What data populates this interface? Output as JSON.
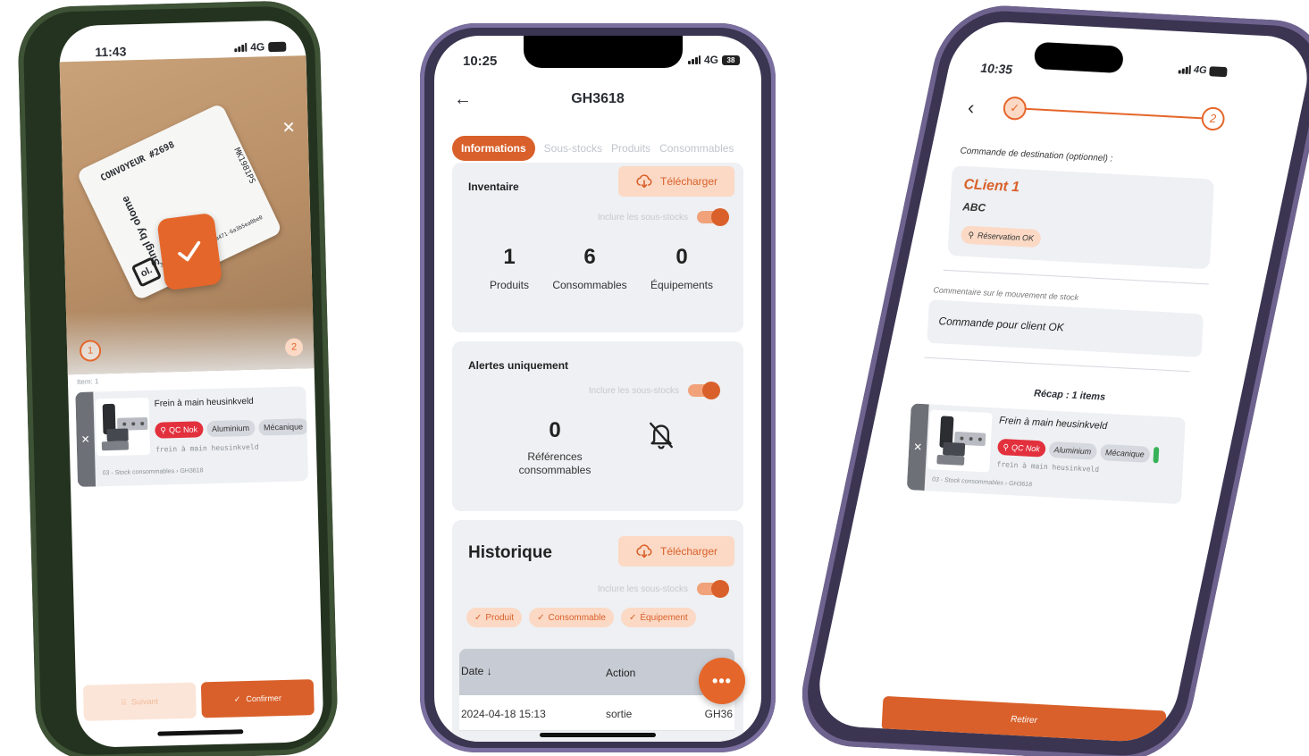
{
  "colors": {
    "accent": "#e5662a",
    "accent_dark": "#d9602a",
    "accent_light": "#fbd9c5",
    "danger": "#e2303d",
    "card_bg": "#eef0f3"
  },
  "phone1": {
    "time": "11:43",
    "network": "4G",
    "label": {
      "line1": "CONVOYEUR #2698",
      "brand": "Singl by olome",
      "code_side": "MK1981PS",
      "code_bottom": "30ed7213-5e6e-48ed-a471-6a3b5ea0be0",
      "logo": "ol."
    },
    "steps": [
      "1",
      "2"
    ],
    "item_count_label": "Item: 1",
    "item": {
      "title": "Frein à main heusinkveld",
      "chips": [
        "QC Nok",
        "Aluminium",
        "Mécanique"
      ],
      "mono": "frein à main heusinkveld",
      "path_from": "03 - Stock consommables",
      "path_to": "GH3618"
    },
    "buttons": {
      "secondary": "Suivant",
      "confirm": "Confirmer"
    }
  },
  "phone2": {
    "time": "10:25",
    "network": "4G",
    "battery": "38",
    "title": "GH3618",
    "tabs": [
      "Informations",
      "Sous-stocks",
      "Produits",
      "Consommables"
    ],
    "inventory": {
      "heading": "Inventaire",
      "download": "Télécharger",
      "toggle_label": "Inclure les sous-stocks",
      "stats": [
        {
          "value": "1",
          "label": "Produits"
        },
        {
          "value": "6",
          "label": "Consommables"
        },
        {
          "value": "0",
          "label": "Équipements"
        }
      ]
    },
    "alerts": {
      "heading": "Alertes uniquement",
      "toggle_label": "Inclure les sous-stocks",
      "value": "0",
      "label_line1": "Références",
      "label_line2": "consommables"
    },
    "history": {
      "heading": "Historique",
      "download": "Télécharger",
      "toggle_label": "Inclure les sous-stocks",
      "filters": [
        "Produit",
        "Consommable",
        "Équipement"
      ],
      "columns": [
        "Date",
        "Action"
      ],
      "rows": [
        {
          "date": "2024-04-18 15:13",
          "action": "sortie",
          "ref": "GH36"
        }
      ]
    }
  },
  "phone3": {
    "time": "10:35",
    "network": "4G",
    "steps": [
      "✓",
      "2"
    ],
    "destination_label": "Commande de destination (optionnel) :",
    "client": {
      "name": "CLient 1",
      "code": "ABC",
      "badge": "Réservation OK"
    },
    "comment_label": "Commentaire sur le mouvement de stock",
    "comment_value": "Commande pour client OK",
    "recap": "Récap : 1 items",
    "item": {
      "title": "Frein à main heusinkveld",
      "chips": [
        "QC Nok",
        "Aluminium",
        "Mécanique"
      ],
      "mono": "frein à main heusinkveld",
      "path_from": "03 - Stock consommables",
      "path_to": "GH3618"
    },
    "button": "Retirer"
  }
}
